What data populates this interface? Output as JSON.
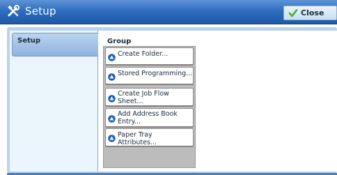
{
  "window": {
    "title": "Setup",
    "title_icon": "tools-icon",
    "close_label": "Close",
    "close_icon": "checkmark-icon"
  },
  "sidebar": {
    "tab_label": "Setup"
  },
  "main": {
    "group_label": "Group",
    "items": [
      {
        "label": "Create Folder...",
        "icon": "up-arrow-circle-icon"
      },
      {
        "label": "Stored Programming...",
        "icon": "up-arrow-circle-icon"
      },
      {
        "label": "Create Job Flow Sheet...",
        "icon": "up-arrow-circle-icon"
      },
      {
        "label": "Add Address Book Entry...",
        "icon": "up-arrow-circle-icon"
      },
      {
        "label": "Paper Tray Attributes...",
        "icon": "up-arrow-circle-icon"
      }
    ]
  },
  "colors": {
    "titlebar": "#2f6dbf",
    "tab": "#8fb2e0",
    "list_bg": "#bcbcbc",
    "accent_check": "#4caf2a"
  }
}
